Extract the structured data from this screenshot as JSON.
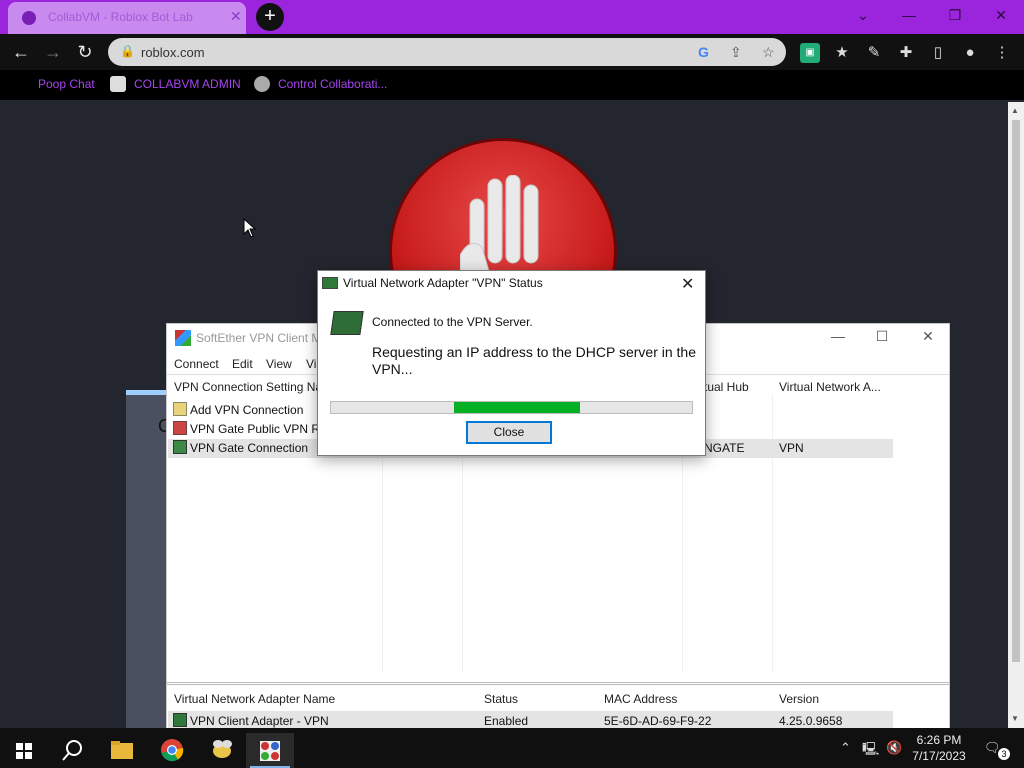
{
  "browser": {
    "tab_title": "CollabVM - Roblox Bot Lab",
    "new_tab_symbol": "+",
    "url": "roblox.com",
    "bookmarks": [
      "Poop Chat",
      "COLLABVM ADMIN",
      "Control Collaborati..."
    ]
  },
  "softether": {
    "title": "SoftEther VPN Client M",
    "menu": [
      "Connect",
      "Edit",
      "View",
      "Vi"
    ],
    "columns": [
      "VPN Connection Setting Na",
      "tual Hub",
      "Virtual Network A..."
    ],
    "rows": [
      {
        "name": "Add VPN Connection",
        "hub": "",
        "adapter": ""
      },
      {
        "name": "VPN Gate Public VPN Re",
        "hub": "",
        "adapter": ""
      },
      {
        "name": "VPN Gate Connection",
        "hub": "NGATE",
        "adapter": "VPN"
      }
    ],
    "adapter_columns": [
      "Virtual Network Adapter Name",
      "Status",
      "MAC Address",
      "Version"
    ],
    "adapter_row": {
      "name": "VPN Client Adapter - VPN",
      "status": "Enabled",
      "mac": "5E-6D-AD-69-F9-22",
      "version": "4.25.0.9658"
    },
    "left_fragment": "C"
  },
  "dialog": {
    "title": "Virtual Network Adapter \"VPN\" Status",
    "message1": "Connected to the VPN Server.",
    "message2": "Requesting an IP address to the DHCP server in the VPN...",
    "progress_start": 0.34,
    "progress_end": 0.69,
    "close_label": "Close"
  },
  "taskbar": {
    "time": "6:26 PM",
    "date": "7/17/2023",
    "notification_count": "3"
  },
  "colors": {
    "accent": "#9b25dc",
    "progress": "#06b025"
  }
}
